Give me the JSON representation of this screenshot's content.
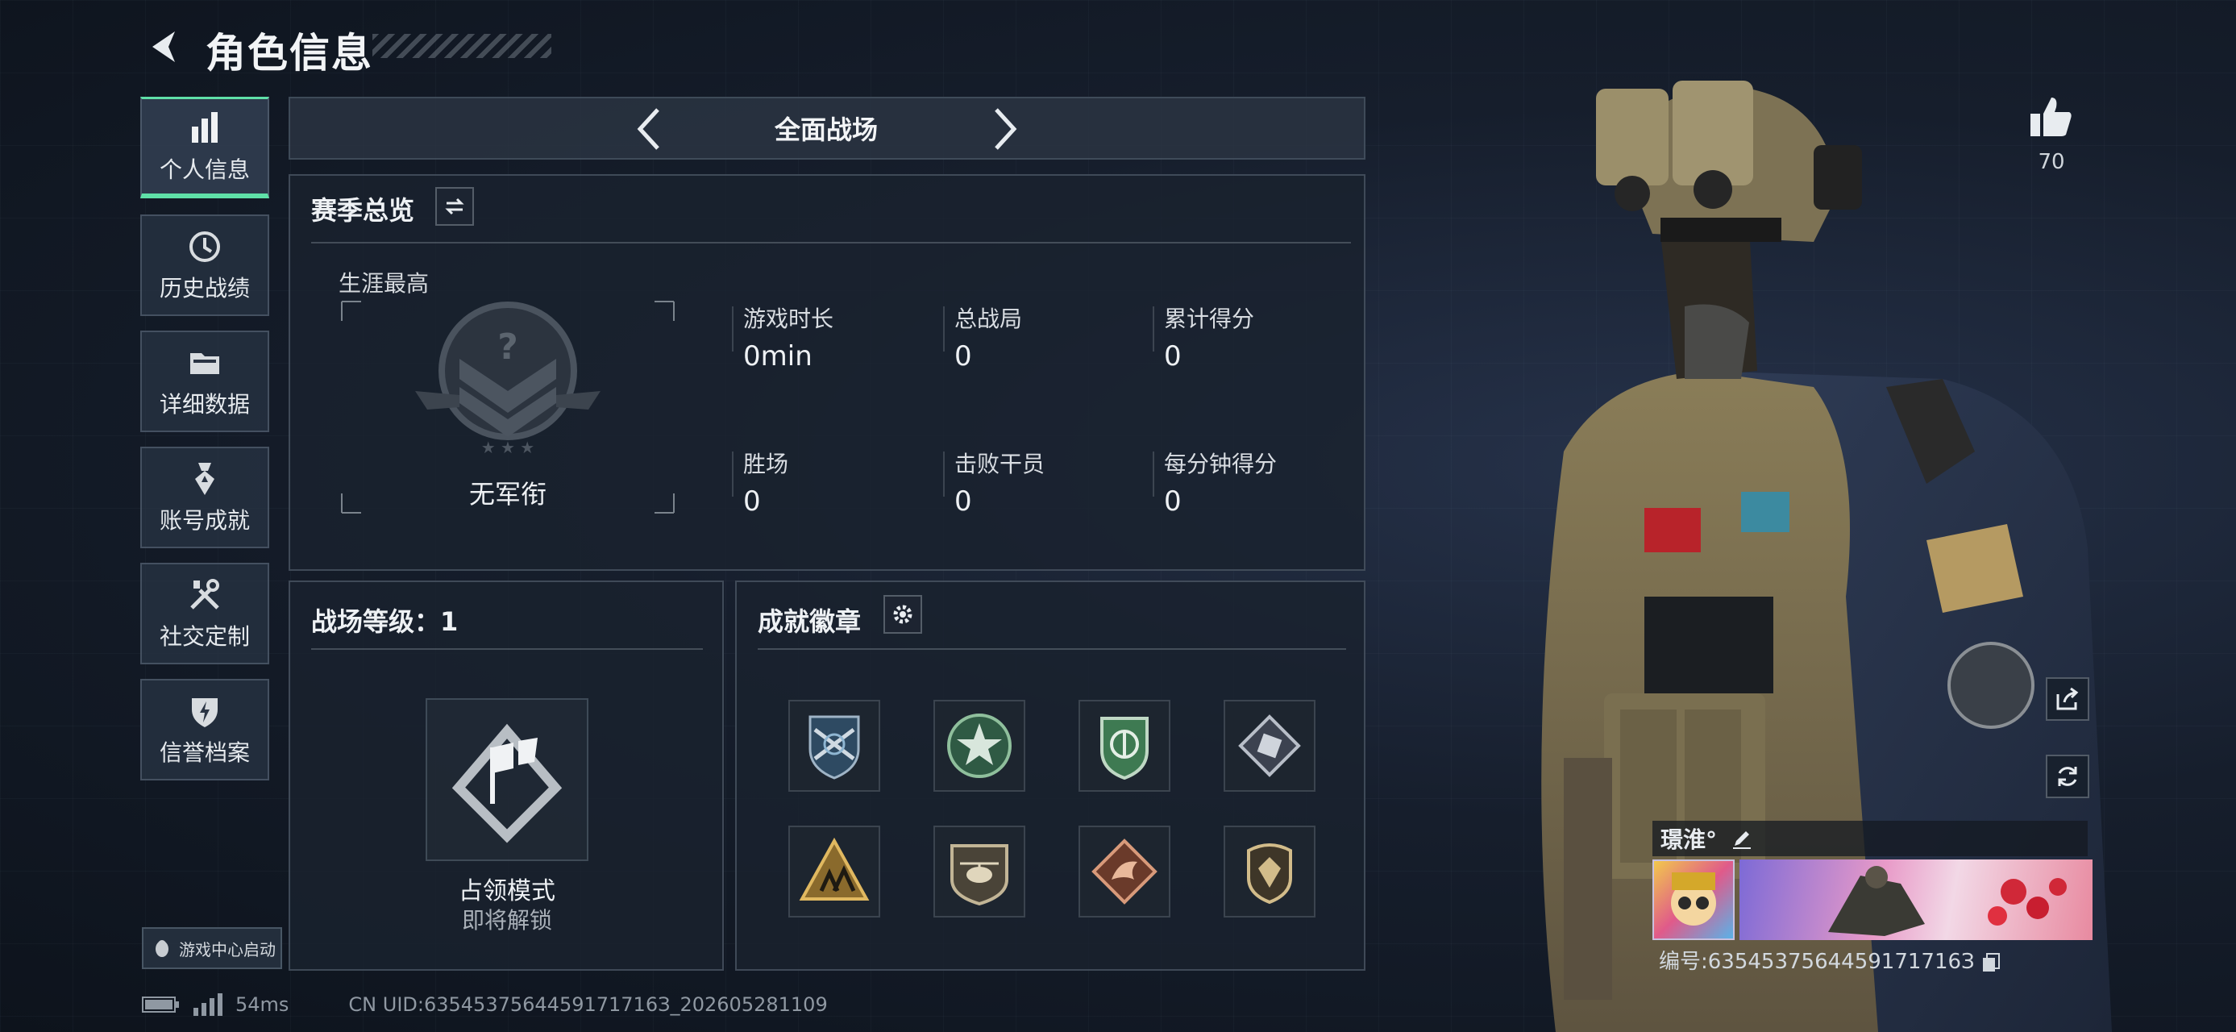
{
  "header": {
    "title": "角色信息"
  },
  "sidebar": {
    "items": [
      {
        "label": "个人信息",
        "icon": "bar-chart-icon",
        "active": true
      },
      {
        "label": "历史战绩",
        "icon": "history-clock-icon"
      },
      {
        "label": "详细数据",
        "icon": "folder-icon"
      },
      {
        "label": "账号成就",
        "icon": "medal-icon"
      },
      {
        "label": "社交定制",
        "icon": "tools-icon"
      },
      {
        "label": "信誉档案",
        "icon": "shield-bolt-icon"
      }
    ],
    "game_center": "游戏中心启动"
  },
  "mode": {
    "label": "全面战场"
  },
  "season": {
    "title": "赛季总览",
    "career_label": "生涯最高",
    "rank_label": "无军衔",
    "stats": [
      {
        "label": "游戏时长",
        "value": "0min"
      },
      {
        "label": "总战局",
        "value": "0"
      },
      {
        "label": "累计得分",
        "value": "0"
      },
      {
        "label": "胜场",
        "value": "0"
      },
      {
        "label": "击败干员",
        "value": "0"
      },
      {
        "label": "每分钟得分",
        "value": "0"
      }
    ]
  },
  "battle_level": {
    "title": "战场等级：1",
    "mode_name": "占领模式",
    "lock_text": "即将解锁"
  },
  "achievements": {
    "title": "成就徽章",
    "badges": [
      "crossed-rifles-badge",
      "star-badge",
      "green-shield-badge",
      "diamond-dice-badge",
      "triangle-squad-badge",
      "helicopter-badge",
      "dragon-badge",
      "crest-badge"
    ]
  },
  "status_bar": {
    "ping": "54ms",
    "uid": "CN UID:6354537564459171716З_202605281109"
  },
  "profile": {
    "likes": "70",
    "player_name": "璟淮°",
    "player_id": "编号:6354537564459171716З"
  },
  "colors": {
    "accent": "#5fe0a8",
    "panel_bg": "#1a222e"
  }
}
